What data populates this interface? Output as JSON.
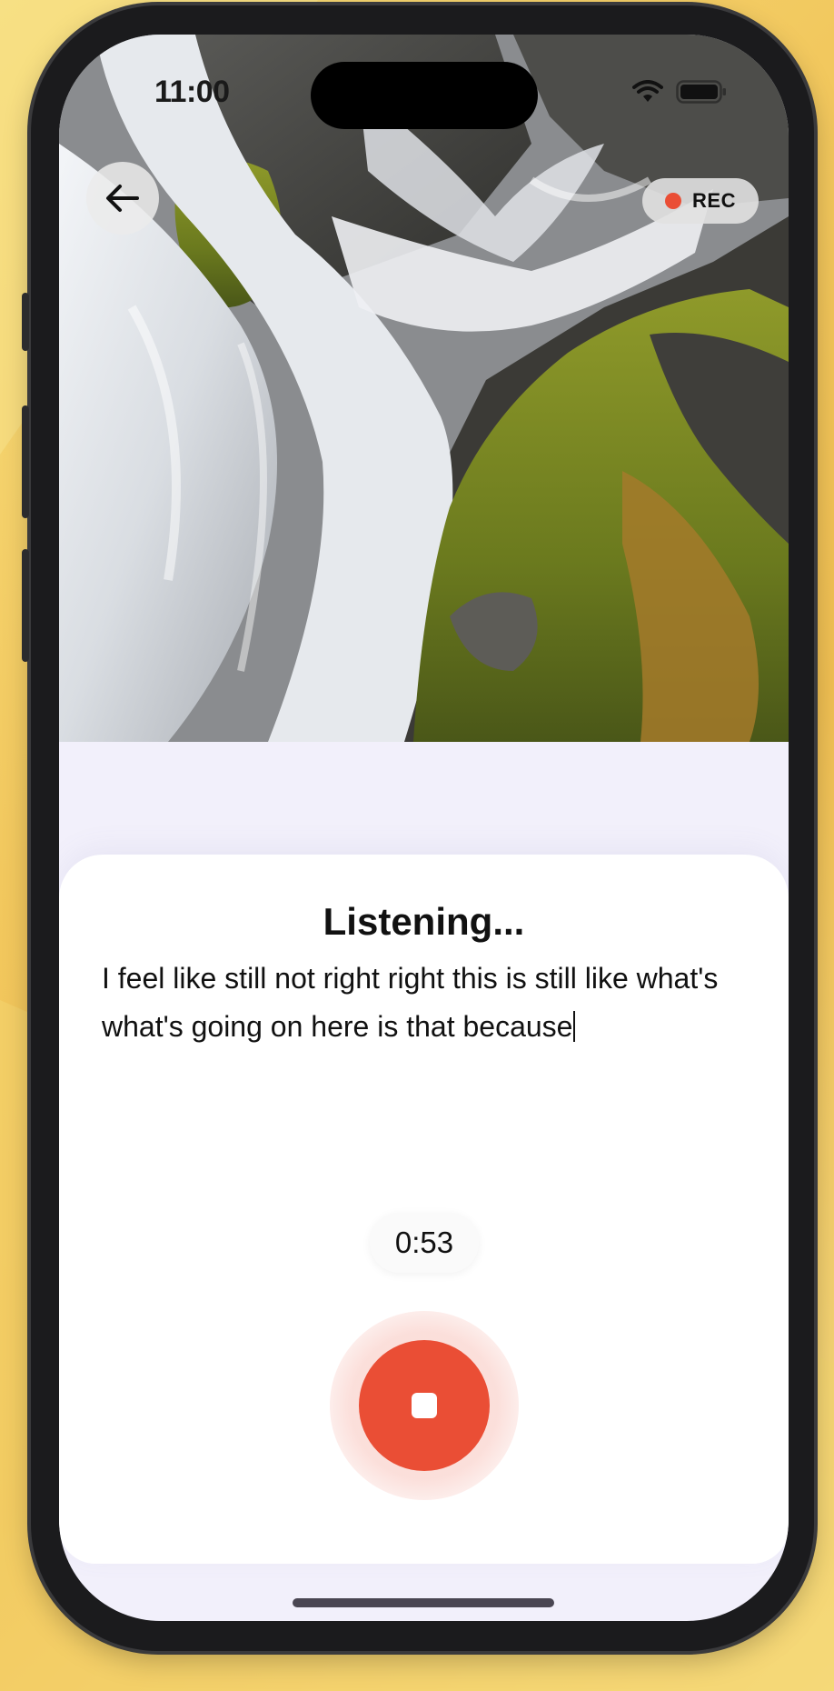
{
  "status_bar": {
    "time": "11:00"
  },
  "header": {
    "rec_label": "REC"
  },
  "sheet": {
    "title": "Listening...",
    "transcript": "I feel like still not right right this is still like what's what's going on here is that because"
  },
  "recorder": {
    "elapsed": "0:53"
  },
  "colors": {
    "accent": "#ea4e35",
    "sheet": "#ffffff",
    "screen_bg": "#f2f0fb"
  }
}
